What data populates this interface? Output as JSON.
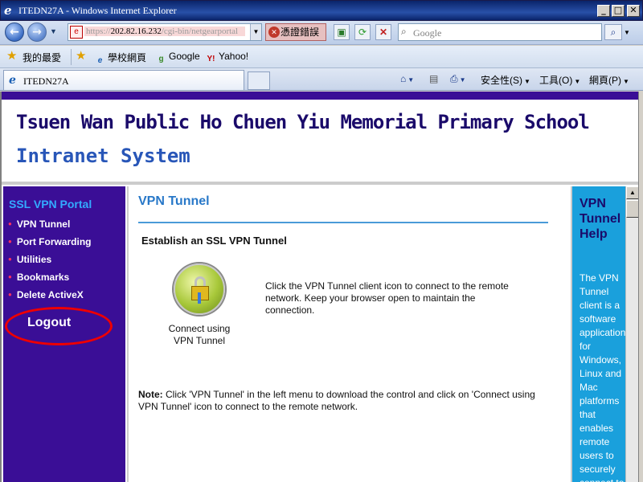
{
  "window": {
    "title": "ITEDN27A - Windows Internet Explorer",
    "min_glyph": "_",
    "max_glyph": "□",
    "close_glyph": "✕"
  },
  "toolbar": {
    "url_prefix": "https://",
    "url_host": "202.82.16.232",
    "url_path": "/cgi-bin/netgearportal",
    "cert_error": "憑證錯誤",
    "search_placeholder": "Google"
  },
  "favorites": {
    "label": "我的最愛",
    "items": [
      "學校網頁",
      "Google",
      "Yahoo!"
    ]
  },
  "tabs": {
    "active": "ITEDN27A"
  },
  "commands": {
    "safety": "安全性(S)",
    "tools": "工具(O)",
    "page": "網頁(P)"
  },
  "page": {
    "school_name": "Tsuen Wan Public Ho Chuen Yiu Memorial Primary School",
    "system_name": "Intranet System",
    "sidebar": {
      "title": "SSL VPN Portal",
      "items": [
        "VPN Tunnel",
        "Port Forwarding",
        "Utilities",
        "Bookmarks",
        "Delete ActiveX"
      ],
      "logout": "Logout"
    },
    "content": {
      "title": "VPN Tunnel",
      "subtitle": "Establish an SSL VPN Tunnel",
      "icon_caption_1": "Connect using",
      "icon_caption_2": "VPN Tunnel",
      "description": "Click the VPN Tunnel client icon to connect to the remote network. Keep your browser open to maintain the connection.",
      "note_label": "Note:",
      "note_text": " Click 'VPN Tunnel' in the left menu to download the control and click on 'Connect using VPN Tunnel' icon to connect to the remote network."
    },
    "help": {
      "title": "VPN Tunnel Help",
      "text": "The VPN Tunnel client is a software application for Windows, Linux and Mac platforms that enables remote users to securely connect to"
    }
  },
  "colors": {
    "portal_purple": "#3a0e96",
    "help_blue": "#1aa0dc",
    "title_blue": "#2878c8",
    "logout_ring": "#ee0000"
  }
}
